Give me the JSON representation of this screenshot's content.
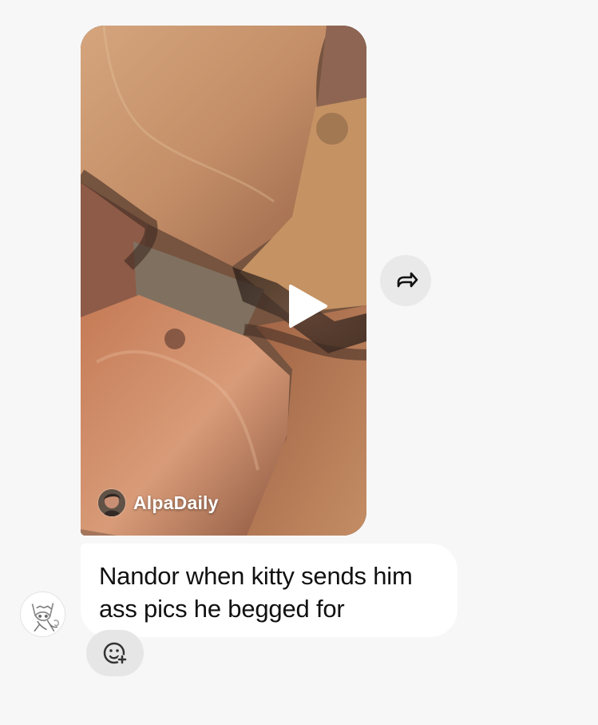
{
  "reel": {
    "author": "AlpaDaily",
    "media_icon": "play-icon",
    "author_avatar_icon": "author-avatar"
  },
  "share": {
    "icon": "share-forward-icon"
  },
  "message": {
    "lines": [
      "Nandor when kitty sends him",
      "ass pics he begged for"
    ]
  },
  "sender": {
    "avatar_icon": "sketch-avatar"
  },
  "reaction": {
    "icon": "add-reaction-icon"
  },
  "colors": {
    "background": "#f7f7f7",
    "bubble": "#ffffff",
    "button_background": "#e9e9ea",
    "text": "#111111"
  }
}
